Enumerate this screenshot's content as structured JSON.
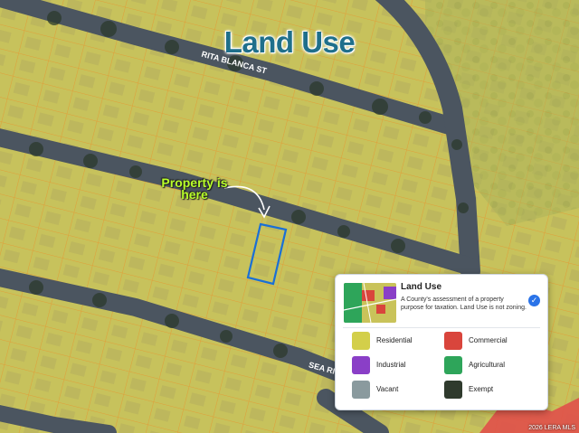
{
  "map": {
    "title": "Land Use",
    "street_labels": [
      "RITA BLANCA ST",
      "SEA RI"
    ],
    "annotation_line1": "Property is",
    "annotation_line2": "here",
    "credit": "2026 LERA MLS"
  },
  "legend_panel": {
    "title": "Land Use",
    "description": "A County's assessment of a property purpose for taxation. Land Use is not zoning.",
    "checked": true,
    "items": [
      {
        "label": "Residential",
        "color": "#d3cf4a",
        "icon": "residential-swatch"
      },
      {
        "label": "Commercial",
        "color": "#d9453c",
        "icon": "commercial-swatch"
      },
      {
        "label": "Industrial",
        "color": "#8a3fc7",
        "icon": "industrial-swatch"
      },
      {
        "label": "Agricultural",
        "color": "#2ea55a",
        "icon": "agricultural-swatch"
      },
      {
        "label": "Vacant",
        "color": "#8a9a9e",
        "icon": "vacant-swatch"
      },
      {
        "label": "Exempt",
        "color": "#2f3a2d",
        "icon": "exempt-swatch"
      }
    ]
  },
  "colors": {
    "residential_fill": "#c9c35a",
    "parcel_outline": "#e09a33",
    "road": "#4b5560",
    "highlight": "#1a6fd6",
    "commercial_fill": "#e0504a"
  }
}
